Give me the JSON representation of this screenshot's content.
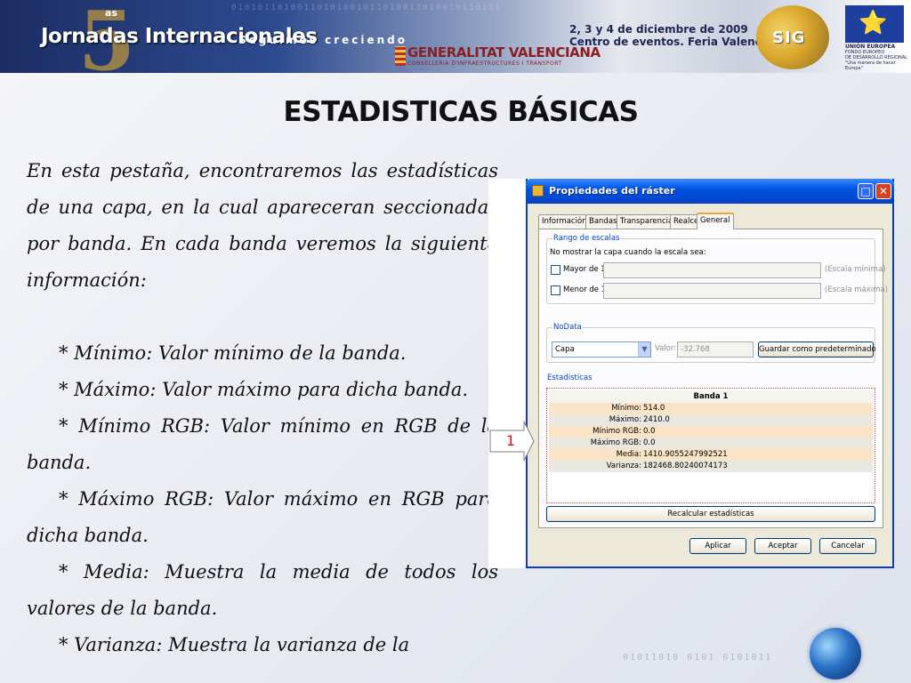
{
  "banner": {
    "number": "5",
    "ordinal": "as",
    "event_name": "Jornadas Internacionales",
    "slogan": "Seguimos creciendo",
    "sponsor_name": "GENERALITAT VALENCIANA",
    "sponsor_subtitle": "CONSELLERIA D'INFRAESTRUCTURES I TRANSPORT",
    "dates": "2, 3 y 4 de diciembre de 2009",
    "venue": "Centro de eventos. Feria Valencia",
    "gvsig_logo_text": "SIG",
    "eu_name": "UNIÓN EUROPEA",
    "eu_fund_line1": "FONDO EUROPEO",
    "eu_fund_line2": "DE DESARROLLO REGIONAL",
    "eu_slogan": "\"Una manera de hacer Europa\"",
    "binary_digits": "01010110100110101001011010011010010110101",
    "eu_stars": "⭐"
  },
  "slide": {
    "title": "ESTADISTICAS BÁSICAS",
    "intro": "En esta pestaña, encontraremos las estadísticas de una capa, en la cual apareceran seccionadas por banda. En cada banda veremos la siguiente información:",
    "bullets": [
      "* Mínimo: Valor mínimo de la banda.",
      "* Máximo: Valor máximo para dicha banda.",
      "* Mínimo RGB: Valor mínimo en RGB de la banda.",
      "* Máximo RGB: Valor máximo en RGB para dicha banda.",
      "* Media: Muestra la media de todos los valores de la banda.",
      "* Varianza: Muestra la varianza de la"
    ],
    "callout_number": "1",
    "footer_digits": "01011010 0101 0101011"
  },
  "dialog": {
    "title": "Propiedades del ráster",
    "maximize_glyph": "□",
    "close_glyph": "✕",
    "tabs": [
      "Información",
      "Bandas",
      "Transparencia",
      "Realce",
      "General"
    ],
    "active_tab_index": 4,
    "scale_group": {
      "label": "Rango de escalas",
      "hint": "No mostrar la capa cuando la escala sea:",
      "greater_label": "Mayor de 1:",
      "greater_suffix": "(Escala mínima)",
      "less_label": "Menor de 1:",
      "less_suffix": "(Escala máxima)"
    },
    "nodata_group": {
      "label": "NoData",
      "combo_value": "Capa",
      "value_label": "Valor:",
      "value": "-32.768",
      "save_default_button": "Guardar como predeterminado"
    },
    "stats_group": {
      "label": "Estadisticas",
      "band_header": "Banda 1",
      "rows": [
        {
          "label": "Mínimo:",
          "value": "514.0"
        },
        {
          "label": "Máximo:",
          "value": "2410.0"
        },
        {
          "label": "Mínimo RGB:",
          "value": "0.0"
        },
        {
          "label": "Máximo RGB:",
          "value": "0.0"
        },
        {
          "label": "Media:",
          "value": "1410.9055247992521"
        },
        {
          "label": "Varianza:",
          "value": "182468.80240074173"
        }
      ],
      "recalc_button": "Recalcular estadísticas"
    },
    "buttons": {
      "apply": "Aplicar",
      "accept": "Aceptar",
      "cancel": "Cancelar"
    }
  }
}
